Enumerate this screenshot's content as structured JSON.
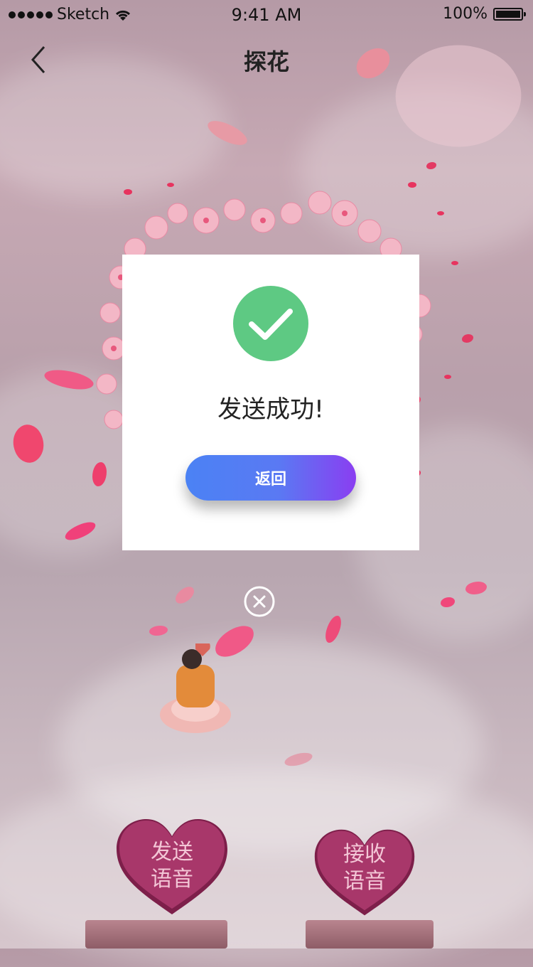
{
  "status_bar": {
    "carrier": "Sketch",
    "time": "9:41 AM",
    "battery": "100%"
  },
  "nav": {
    "title": "探花"
  },
  "dialog": {
    "message": "发送成功!",
    "return_label": "返回"
  },
  "buttons": {
    "send_voice": {
      "line1": "发送",
      "line2": "语音"
    },
    "receive_voice": {
      "line1": "接收",
      "line2": "语音"
    }
  },
  "colors": {
    "success": "#5ec983",
    "button_gradient_start": "#4b82f4",
    "button_gradient_end": "#8a3ef1",
    "heart": "#a8376a"
  },
  "icons": [
    "back-chevron-icon",
    "wifi-icon",
    "battery-icon",
    "check-icon",
    "close-circle-icon",
    "heart-icon"
  ]
}
